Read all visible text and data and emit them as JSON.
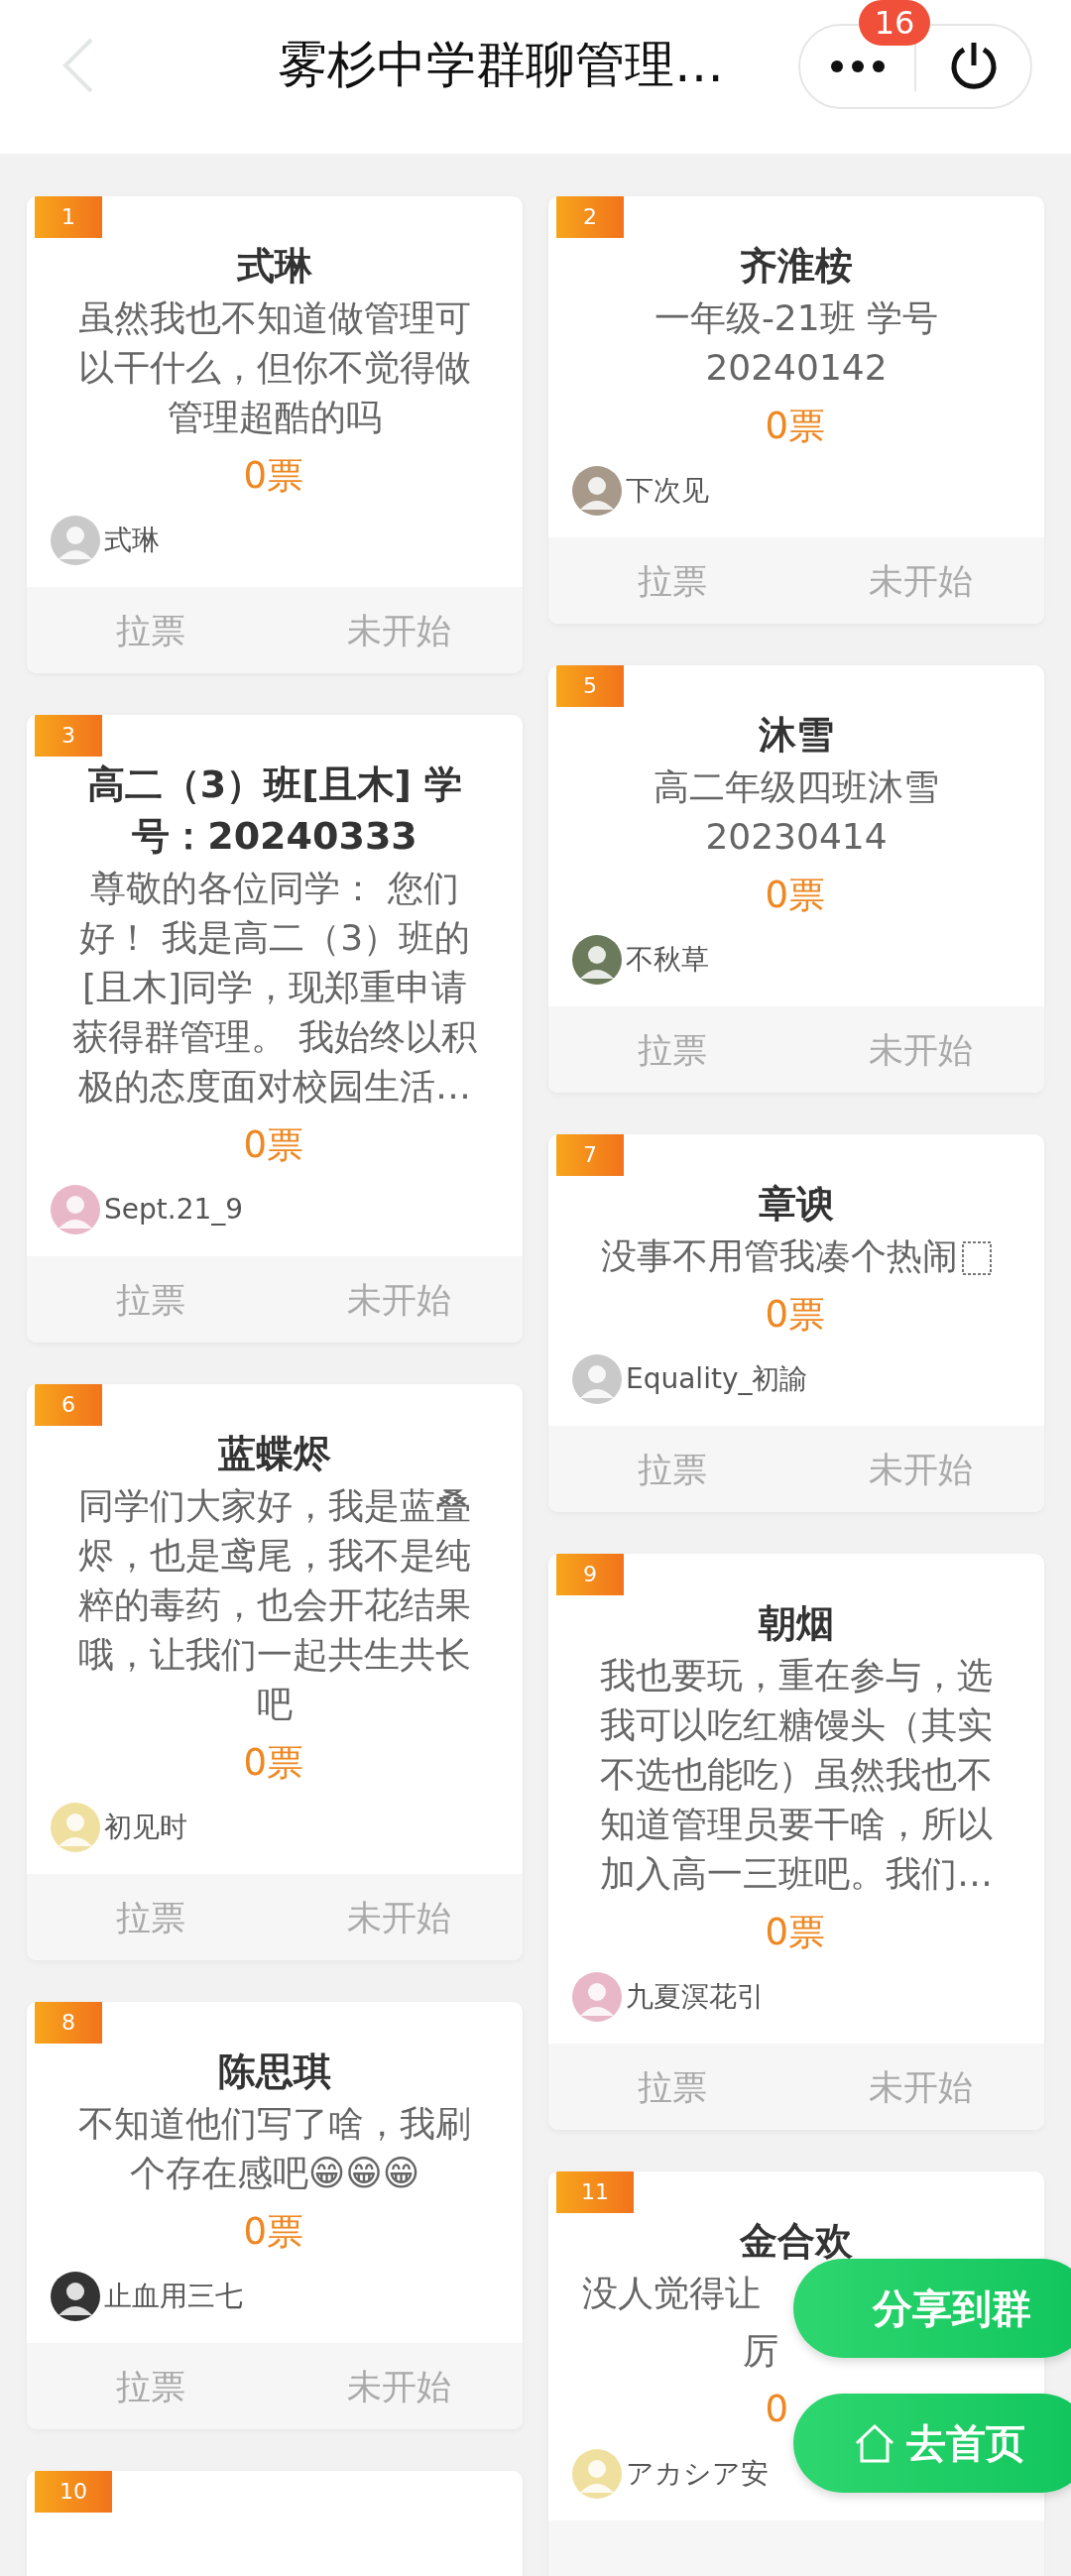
{
  "header": {
    "title": "雾杉中学群聊管理…",
    "back_disabled": true,
    "badge": "16"
  },
  "columns": [
    [
      {
        "rank": "1",
        "name": "式琳",
        "description": "虽然我也不知道做管理可以干什么，但你不觉得做管理超酷的吗",
        "votes": "0票",
        "owner": "式琳",
        "vote_button": "拉票",
        "status": "未开始"
      },
      {
        "rank": "3",
        "name": "高二（3）班[且木] 学号：20240333",
        "description": "尊敬的各位同学： 您们好！ 我是高二（3）班的[且木]同学，现郑重申请获得群管理。 我始终以积极的态度面对校园生活…",
        "votes": "0票",
        "owner": "Sept.21_9",
        "vote_button": "拉票",
        "status": "未开始"
      },
      {
        "rank": "6",
        "name": "蓝蝶烬",
        "description": "同学们大家好，我是蓝叠烬，也是鸢尾，我不是纯粹的毒药，也会开花结果哦，让我们一起共生共长吧",
        "votes": "0票",
        "owner": "初见时",
        "vote_button": "拉票",
        "status": "未开始"
      },
      {
        "rank": "8",
        "name": "陈思琪",
        "description": "不知道他们写了啥，我刷个存在感吧😁😁😁",
        "votes": "0票",
        "owner": "止血用三七",
        "vote_button": "拉票",
        "status": "未开始"
      },
      {
        "rank": "10"
      }
    ],
    [
      {
        "rank": "2",
        "name": "齐淮桉",
        "description": "一年级-21班  学号20240142",
        "votes": "0票",
        "owner": "下次见",
        "vote_button": "拉票",
        "status": "未开始"
      },
      {
        "rank": "5",
        "name": "沐雪",
        "description": "高二年级四班沐雪 20230414",
        "votes": "0票",
        "owner": "不秋草",
        "vote_button": "拉票",
        "status": "未开始"
      },
      {
        "rank": "7",
        "name": "章谀",
        "description": "没事不用管我凑个热闹",
        "trailing_object": true,
        "votes": "0票",
        "owner": "Equality_初諭",
        "vote_button": "拉票",
        "status": "未开始"
      },
      {
        "rank": "9",
        "name": "朝烟",
        "description": "我也要玩，重在参与，选我可以吃红糖馒头（其实不选也能吃）虽然我也不知道管理员要干啥，所以加入高一三班吧。我们…",
        "votes": "0票",
        "owner": "九夏溟花引",
        "vote_button": "拉票",
        "status": "未开始"
      },
      {
        "rank": "11",
        "name": "金合欢",
        "description_lines": [
          "没人觉得让",
          "厉"
        ],
        "votes": "0",
        "owner": "アカシア安"
      }
    ]
  ],
  "floating_buttons": [
    {
      "kind": "share",
      "label": "分享到群"
    },
    {
      "kind": "home",
      "label": "去首页"
    }
  ]
}
